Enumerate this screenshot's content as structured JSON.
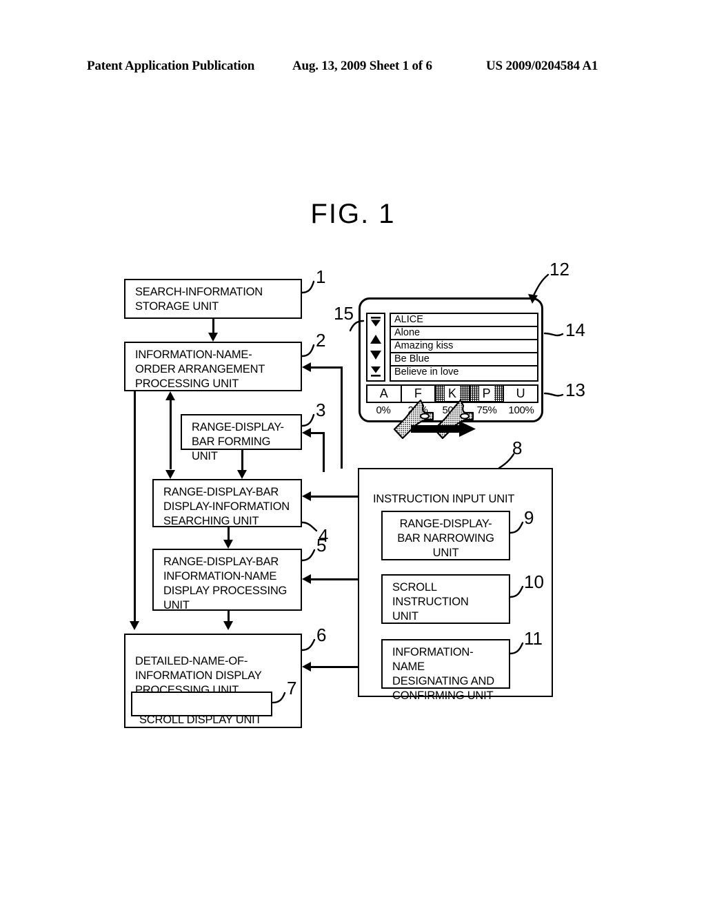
{
  "header": {
    "left": "Patent Application Publication",
    "middle": "Aug. 13, 2009  Sheet 1 of 6",
    "right": "US 2009/0204584 A1"
  },
  "figure": {
    "title": "FIG. 1"
  },
  "flowchart": {
    "boxes": [
      {
        "ref": "1",
        "label": "SEARCH-INFORMATION\nSTORAGE UNIT"
      },
      {
        "ref": "2",
        "label": "INFORMATION-NAME-\nORDER ARRANGEMENT\nPROCESSING UNIT"
      },
      {
        "ref": "3",
        "label": "RANGE-DISPLAY-\nBAR FORMING UNIT"
      },
      {
        "ref": "4",
        "label": "RANGE-DISPLAY-BAR\nDISPLAY-INFORMATION\nSEARCHING UNIT"
      },
      {
        "ref": "5",
        "label": "RANGE-DISPLAY-BAR\nINFORMATION-NAME\nDISPLAY PROCESSING\nUNIT"
      },
      {
        "ref": "6",
        "label": "DETAILED-NAME-OF-\nINFORMATION DISPLAY\nPROCESSING UNIT"
      },
      {
        "ref": "7",
        "label": "SCROLL DISPLAY UNIT"
      },
      {
        "ref": "8",
        "label": "INSTRUCTION INPUT UNIT"
      },
      {
        "ref": "9",
        "label": "RANGE-DISPLAY-\nBAR NARROWING\nUNIT"
      },
      {
        "ref": "10",
        "label": "SCROLL\nINSTRUCTION\nUNIT"
      },
      {
        "ref": "11",
        "label": "INFORMATION-NAME\nDESIGNATING AND\nCONFIRMING UNIT"
      }
    ]
  },
  "device": {
    "ref": "12",
    "scrollbar": {
      "ref": "15",
      "buttons": [
        {
          "icon": "scroll-to-top-icon"
        },
        {
          "icon": "scroll-up-icon"
        },
        {
          "icon": "scroll-down-icon"
        },
        {
          "icon": "scroll-to-bottom-icon"
        }
      ]
    },
    "list": {
      "ref": "14",
      "items": [
        "ALICE",
        "Alone",
        "Amazing kiss",
        "Be Blue",
        "Believe in love"
      ]
    },
    "range_bar": {
      "ref": "13",
      "cells": [
        {
          "letter": "A",
          "hatched": false
        },
        {
          "letter": "F",
          "hatched": false
        },
        {
          "letter": "K",
          "hatched": true
        },
        {
          "letter": "P",
          "hatched": true
        },
        {
          "letter": "U",
          "hatched": false
        }
      ],
      "scale": [
        "0%",
        "25%",
        "50%",
        "75%",
        "100%"
      ]
    },
    "gesture": {
      "icon": "two-finger-spread-gesture-icon"
    }
  }
}
